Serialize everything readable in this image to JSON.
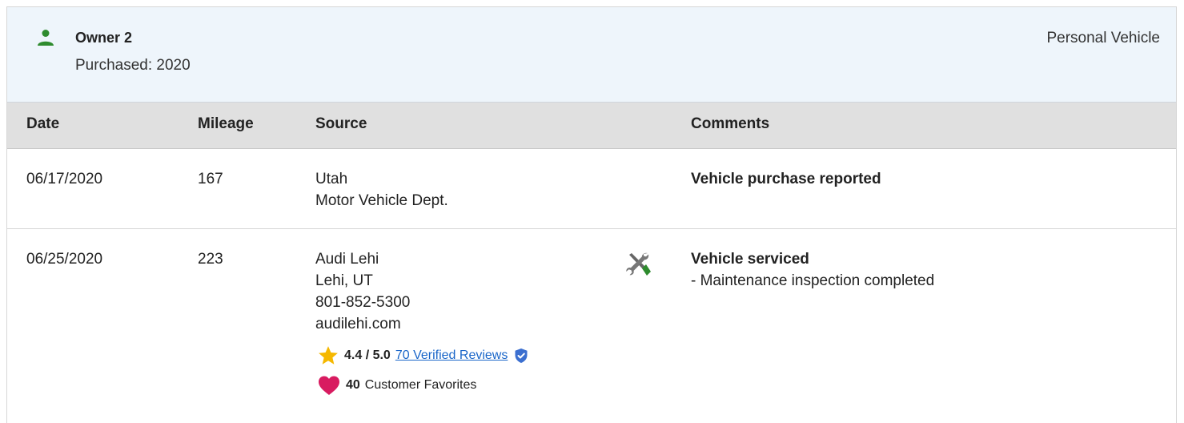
{
  "owner": {
    "title": "Owner 2",
    "purchased": "Purchased: 2020",
    "type": "Personal Vehicle",
    "icon": "person-icon",
    "icon_color": "#2e8b2e"
  },
  "columns": {
    "date": "Date",
    "mileage": "Mileage",
    "source": "Source",
    "comments": "Comments"
  },
  "rows": [
    {
      "date": "06/17/2020",
      "mileage": "167",
      "source": [
        "Utah",
        "Motor Vehicle Dept."
      ],
      "comment_title": "Vehicle purchase reported"
    },
    {
      "date": "06/25/2020",
      "mileage": "223",
      "source": [
        "Audi Lehi",
        "Lehi, UT",
        "801-852-5300",
        "audilehi.com"
      ],
      "icon": "wrench-screwdriver-icon",
      "comment_title": "Vehicle serviced",
      "comment_detail": "- Maintenance inspection completed",
      "rating": "4.4 / 5.0",
      "reviews_link": "70 Verified Reviews",
      "favorites_count": "40",
      "favorites_label": "Customer Favorites"
    }
  ],
  "colors": {
    "header_bg": "#eef5fb",
    "column_header_bg": "#e0e0e0",
    "link": "#1a66c9",
    "star": "#f5b800",
    "heart": "#d81b60",
    "verified": "#3b6fd0"
  }
}
